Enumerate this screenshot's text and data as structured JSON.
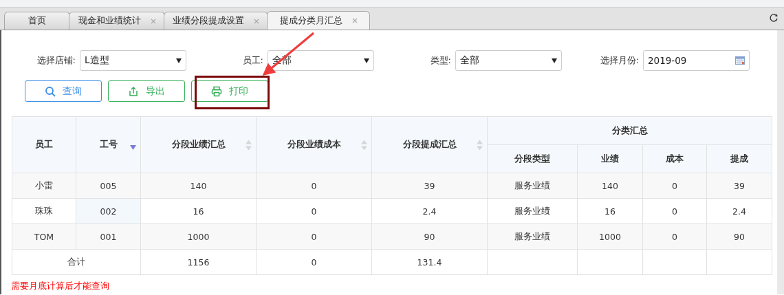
{
  "tabs": [
    {
      "label": "首页",
      "closable": false,
      "selected": false
    },
    {
      "label": "现金和业绩统计",
      "closable": true,
      "selected": false
    },
    {
      "label": "业绩分段提成设置",
      "closable": true,
      "selected": false
    },
    {
      "label": "提成分类月汇总",
      "closable": true,
      "selected": true
    }
  ],
  "filters": [
    {
      "kind": "select",
      "label": "选择店铺:",
      "value": "L造型"
    },
    {
      "kind": "select",
      "label": "员工:",
      "value": "全部"
    },
    {
      "kind": "select",
      "label": "类型:",
      "value": "全部"
    },
    {
      "kind": "date",
      "label": "选择月份:",
      "value": "2019-09"
    }
  ],
  "buttons": [
    {
      "kind": "query",
      "label": "查询"
    },
    {
      "kind": "export",
      "label": "导出"
    },
    {
      "kind": "print",
      "label": "打印"
    }
  ],
  "table": {
    "columns": [
      {
        "label": "员工",
        "kind": "plain"
      },
      {
        "label": "工号",
        "kind": "descending"
      },
      {
        "label": "分段业绩汇总",
        "kind": "sortable"
      },
      {
        "label": "分段业绩成本",
        "kind": "sortable"
      },
      {
        "label": "分段提成汇总",
        "kind": "sortable"
      }
    ],
    "group": {
      "label": "分类汇总",
      "columns": [
        "分段类型",
        "业绩",
        "成本",
        "提成"
      ]
    },
    "rows": [
      [
        {
          "text": "小雷",
          "highlighted": false
        },
        {
          "text": "005",
          "highlighted": false
        },
        {
          "text": "140",
          "highlighted": false
        },
        {
          "text": "0",
          "highlighted": false
        },
        {
          "text": "39",
          "highlighted": false
        },
        {
          "text": "服务业绩",
          "highlighted": false
        },
        {
          "text": "140",
          "highlighted": false
        },
        {
          "text": "0",
          "highlighted": false
        },
        {
          "text": "39",
          "highlighted": false
        }
      ],
      [
        {
          "text": "珠珠",
          "highlighted": false
        },
        {
          "text": "002",
          "highlighted": true
        },
        {
          "text": "16",
          "highlighted": false
        },
        {
          "text": "0",
          "highlighted": false
        },
        {
          "text": "2.4",
          "highlighted": false
        },
        {
          "text": "服务业绩",
          "highlighted": false
        },
        {
          "text": "16",
          "highlighted": false
        },
        {
          "text": "0",
          "highlighted": false
        },
        {
          "text": "2.4",
          "highlighted": false
        }
      ],
      [
        {
          "text": "TOM",
          "highlighted": false
        },
        {
          "text": "001",
          "highlighted": false
        },
        {
          "text": "1000",
          "highlighted": false
        },
        {
          "text": "0",
          "highlighted": false
        },
        {
          "text": "90",
          "highlighted": false
        },
        {
          "text": "服务业绩",
          "highlighted": false
        },
        {
          "text": "1000",
          "highlighted": false
        },
        {
          "text": "0",
          "highlighted": false
        },
        {
          "text": "90",
          "highlighted": false
        }
      ]
    ],
    "total": {
      "label": "合计",
      "cells": [
        "1156",
        "0",
        "131.4"
      ]
    }
  },
  "note": "需要月底计算后才能查询"
}
